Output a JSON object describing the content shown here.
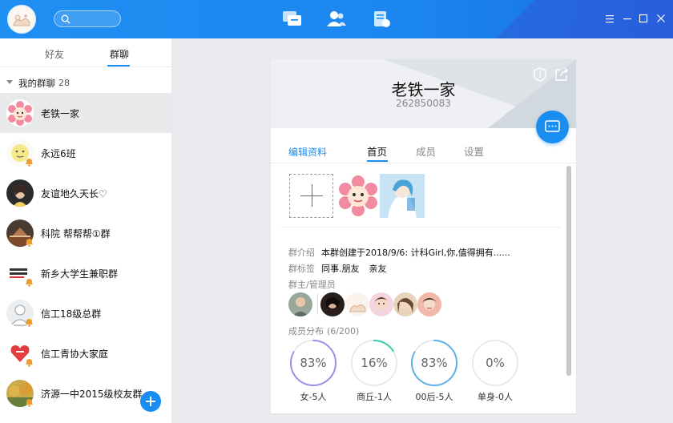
{
  "colors": {
    "accent": "#1a8df0",
    "titlebar": "#1f8ff2",
    "ring_female": "#9b8ee6",
    "ring_business": "#3ec8a8",
    "ring_post00": "#5ab0e8",
    "ring_single": "#e1e4e8"
  },
  "titlebar": {
    "search_placeholder": "",
    "nav": [
      {
        "name": "messages",
        "icon": "chat-bubbles-icon"
      },
      {
        "name": "contacts",
        "icon": "contacts-icon"
      },
      {
        "name": "files",
        "icon": "document-icon"
      }
    ],
    "window_controls": [
      "menu-icon",
      "minimize-icon",
      "maximize-icon",
      "close-icon"
    ]
  },
  "sidebar": {
    "tabs": [
      {
        "label": "好友"
      },
      {
        "label": "群聊"
      }
    ],
    "active_tab": 1,
    "group": {
      "title": "我的群聊",
      "count": "28"
    },
    "items": [
      {
        "label": "老铁一家",
        "selected": true
      },
      {
        "label": "永远6班"
      },
      {
        "label": "友谊地久天长♡"
      },
      {
        "label": "科院 帮帮帮①群"
      },
      {
        "label": "新乡大学生兼职群"
      },
      {
        "label": "信工18级总群"
      },
      {
        "label": "信工青协大家庭"
      },
      {
        "label": "济源一中2015级校友群"
      }
    ]
  },
  "card": {
    "name": "老铁一家",
    "id": "262850083",
    "edit": "编辑资料",
    "tabs": [
      {
        "label": "首页"
      },
      {
        "label": "成员"
      },
      {
        "label": "设置"
      }
    ],
    "active_tab": 0,
    "intro_label": "群介绍",
    "intro": "本群创建于2018/9/6:  计科Girl,你,值得拥有......",
    "tags_label": "群标签",
    "tags": [
      "同事.朋友",
      "亲友"
    ],
    "admins_label": "群主/管理员",
    "dist_label": "成员分布",
    "dist_count": "(6/200)",
    "stats": [
      {
        "pct": "83%",
        "caption": "女-5人",
        "value": 0.83,
        "color": "#9b8ee6"
      },
      {
        "pct": "16%",
        "caption": "商丘-1人",
        "value": 0.16,
        "color": "#3ec8a8"
      },
      {
        "pct": "83%",
        "caption": "00后-5人",
        "value": 0.83,
        "color": "#5ab0e8"
      },
      {
        "pct": "0%",
        "caption": "单身-0人",
        "value": 0.0,
        "color": "#e1e4e8"
      }
    ]
  }
}
